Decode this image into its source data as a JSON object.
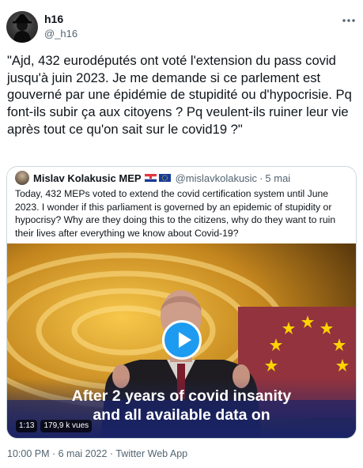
{
  "tweet": {
    "author": {
      "display_name": "h16",
      "handle": "@_h16"
    },
    "more_icon": "more-horizontal-icon",
    "text": "\"Ajd, 432 eurodéputés ont voté l'extension du pass covid jusqu'à juin 2023. Je me demande si ce parlement est gouverné par une épidémie de stupidité ou d'hypocrisie. Pq font-ils subir ça aux citoyens ? Pq veulent-ils ruiner leur vie après tout ce qu'on sait sur le covid19 ?\"",
    "footer": "10:00 PM · 6 mai 2022 · Twitter Web App"
  },
  "quoted": {
    "display_name": "Mislav Kolakusic MEP",
    "flags": [
      "croatia-flag-icon",
      "eu-flag-icon"
    ],
    "handle": "@mislavkolakusic",
    "separator": "·",
    "date": "5 mai",
    "text": "Today, 432 MEPs voted to extend the covid certification system until June 2023. I wonder if this parliament is governed by an epidemic of stupidity or hypocrisy? Why are they doing this to the citizens, why do they want to ruin their lives after everything we know about Covid-19?",
    "video": {
      "caption_line1": "After 2 years of covid insanity",
      "caption_line2": "and all available data on",
      "duration": "1:13",
      "views": "179,9 k vues",
      "play_icon": "play-icon"
    }
  },
  "colors": {
    "accent": "#1d9bf0",
    "secondary_text": "#536471",
    "border": "#cfd9de"
  }
}
